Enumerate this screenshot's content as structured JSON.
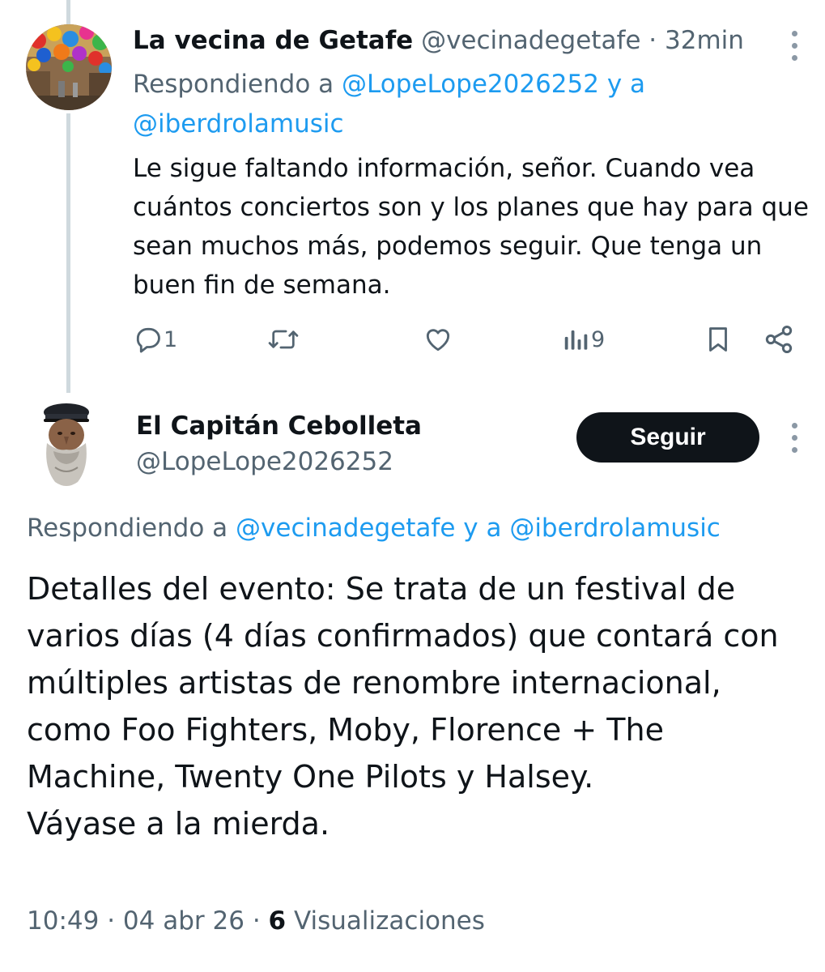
{
  "tweet1": {
    "name": "La vecina de Getafe",
    "handle": "@vecinadegetafe",
    "separator": "·",
    "time": "32min",
    "replying_prefix": "Respondiendo a",
    "replying_user1": "@LopeLope2026252",
    "replying_join": "y a",
    "replying_user2": "@iberdrolamusic",
    "text": "Le sigue faltando información, señor. Cuando vea cuántos conciertos son y los planes que hay para que sean muchos más, podemos seguir. Que tenga un buen fin de semana.",
    "actions": {
      "replies": "1",
      "retweets": "",
      "likes": "",
      "views": "9"
    }
  },
  "tweet2": {
    "name": "El Capitán Cebolleta",
    "handle": "@LopeLope2026252",
    "follow_label": "Seguir",
    "replying_prefix": "Respondiendo a",
    "replying_user1": "@vecinadegetafe",
    "replying_join": "y a",
    "replying_user2": "@iberdrolamusic",
    "text_lines": [
      "Detalles del evento: Se trata de un festival de varios días (4 días confirmados) que contará con múltiples artistas de renombre internacional, como Foo Fighters, Moby, Florence + The Machine, Twenty One Pilots y Halsey.",
      "Váyase a la mierda."
    ],
    "time": "10:49",
    "date": "04 abr 26",
    "views_count": "6",
    "views_label": "Visualizaciones"
  },
  "colors": {
    "text": "#0f1419",
    "secondary": "#536471",
    "link": "#1d9bf0",
    "thread_line": "#cfd9de",
    "button_bg": "#0f1419"
  },
  "icons": [
    "reply-icon",
    "retweet-icon",
    "like-icon",
    "views-icon",
    "bookmark-icon",
    "share-icon",
    "more-options-icon"
  ]
}
